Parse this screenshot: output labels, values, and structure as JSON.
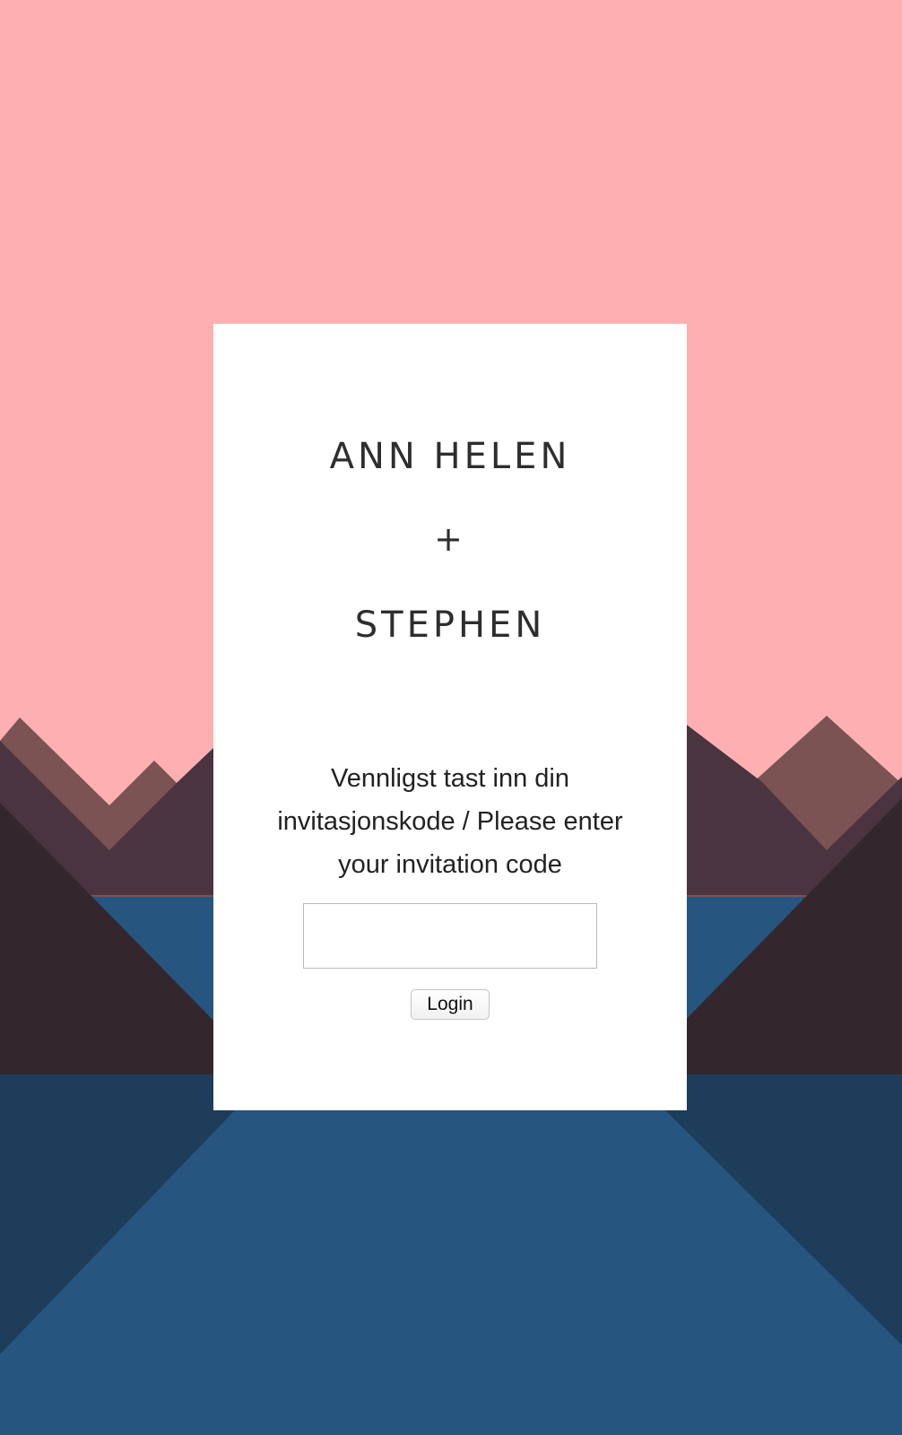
{
  "colors": {
    "sky": "#fdafb1",
    "mountain_light": "#7a5352",
    "mountain_mid": "#4a3440",
    "mountain_dark": "#33272d",
    "lake": "#26567f",
    "lake_shadow": "#1e3d5b",
    "card": "#ffffff",
    "text": "#2e2e2e"
  },
  "card": {
    "name_first": "ANN HELEN",
    "plus": "+",
    "name_second": "STEPHEN",
    "prompt": "Vennligst tast inn din invitasjonskode / Please enter your invitation code",
    "code_input": {
      "value": "",
      "placeholder": ""
    },
    "login_label": "Login"
  }
}
